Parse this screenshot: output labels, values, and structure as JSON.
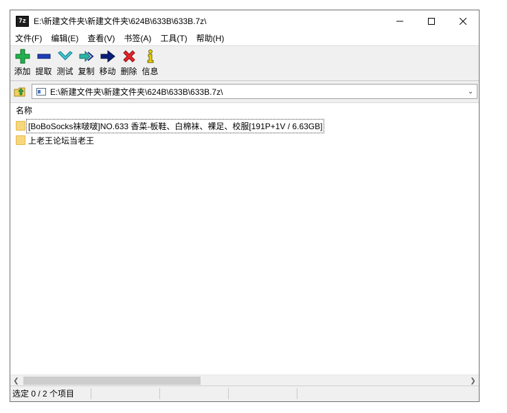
{
  "window": {
    "title": "E:\\新建文件夹\\新建文件夹\\624B\\633B\\633B.7z\\",
    "app_icon_text": "7z",
    "controls": [
      "minimize-icon",
      "maximize-icon",
      "close-icon"
    ]
  },
  "menubar": {
    "items": [
      {
        "label": "文件(F)"
      },
      {
        "label": "编辑(E)"
      },
      {
        "label": "查看(V)"
      },
      {
        "label": "书签(A)"
      },
      {
        "label": "工具(T)"
      },
      {
        "label": "帮助(H)"
      }
    ]
  },
  "toolbar": {
    "items": [
      {
        "label": "添加",
        "icon": "plus-icon",
        "color": "#22b14c"
      },
      {
        "label": "提取",
        "icon": "minus-icon",
        "color": "#1f3fb8"
      },
      {
        "label": "测试",
        "icon": "check-chevron-icon",
        "color": "#27b6c8"
      },
      {
        "label": "复制",
        "icon": "double-arrow-icon",
        "color": "#21a3a3"
      },
      {
        "label": "移动",
        "icon": "arrow-right-icon",
        "color": "#0b1d7a"
      },
      {
        "label": "删除",
        "icon": "x-icon",
        "color": "#e3262c"
      },
      {
        "label": "信息",
        "icon": "info-icon",
        "color": "#e8d300"
      }
    ]
  },
  "address": {
    "path": "E:\\新建文件夹\\新建文件夹\\624B\\633B\\633B.7z\\"
  },
  "list": {
    "column_header": "名称",
    "rows": [
      {
        "name": "[BoBoSocks袜啵啵]NO.633 香菜-板鞋、白棉袜、裸足、校服[191P+1V / 6.63GB]"
      },
      {
        "name": "上老王论坛当老王"
      }
    ]
  },
  "status": {
    "text": "选定 0 / 2 个项目"
  }
}
